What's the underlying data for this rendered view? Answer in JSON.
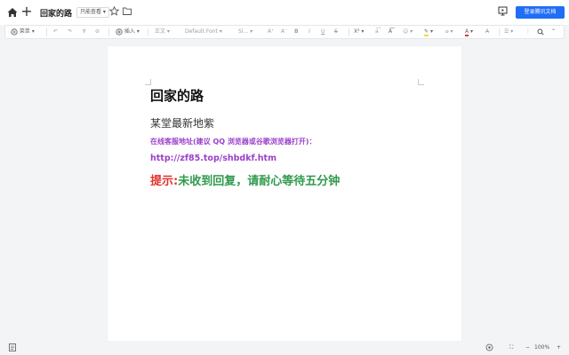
{
  "header": {
    "title": "回家的路",
    "mode_label": "只能查看",
    "login_label": "登录腾讯文档",
    "icons": [
      "home-icon",
      "plus-icon",
      "star-icon",
      "folder-icon",
      "present-icon"
    ]
  },
  "toolbar": {
    "menu_label": "菜单",
    "insert_label": "插入",
    "style_label": "正文",
    "font_label": "Default Font",
    "size_label": "Si..."
  },
  "document": {
    "heading": "回家的路",
    "subheading": "某堂最新地紫",
    "line3": "在线客服地址(建议 QQ 浏览器或谷歌浏览器打开)：",
    "line4": "http://zf85.top/shbdkf.htm",
    "tip_label": "提示:",
    "tip_text": "未收到回复，请耐心等待五分钟"
  },
  "colors": {
    "accent": "#1f6ef5",
    "purple": "#9b41c9",
    "red": "#e0342d",
    "green": "#2e9a4c"
  },
  "status": {
    "zoom": "100%",
    "zoom_minus": "−",
    "zoom_plus": "+"
  }
}
